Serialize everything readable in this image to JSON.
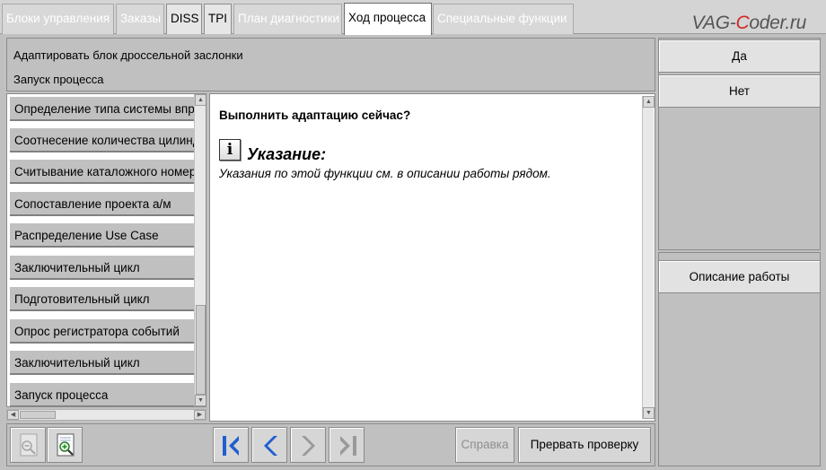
{
  "tabs": [
    {
      "label": "Блоки управления"
    },
    {
      "label": "Заказы"
    },
    {
      "label": "DISS"
    },
    {
      "label": "TPI"
    },
    {
      "label": "План диагностики"
    },
    {
      "label": "Ход процесса"
    },
    {
      "label": "Специальные функции"
    }
  ],
  "watermark": {
    "part1": "VAG-",
    "part2": "C",
    "part3": "oder.ru"
  },
  "header": {
    "title": "Адаптировать блок дроссельной заслонки",
    "subtitle": "Запуск процесса"
  },
  "steps": [
    {
      "label": "Определение типа системы впрыска"
    },
    {
      "label": "Соотнесение количества цилиндров"
    },
    {
      "label": "Считывание каталожного номера"
    },
    {
      "label": "Сопоставление проекта а/м"
    },
    {
      "label": "Распределение Use Case"
    },
    {
      "label": "Заключительный цикл"
    },
    {
      "label": "Подготовительный цикл"
    },
    {
      "label": "Опрос регистратора событий"
    },
    {
      "label": "Заключительный цикл"
    },
    {
      "label": "Запуск процесса"
    }
  ],
  "content": {
    "question": "Выполнить адаптацию сейчас?",
    "info_icon_glyph": "i",
    "note_title": "Указание:",
    "note_text": "Указания по этой функции см. в описании работы рядом."
  },
  "right_buttons": {
    "yes": "Да",
    "no": "Нет",
    "description": "Описание работы"
  },
  "toolbar": {
    "help": "Справка",
    "abort": "Прервать проверку"
  },
  "colors": {
    "nav_active": "#1f5fd0",
    "nav_disabled": "#9a9a9a"
  }
}
